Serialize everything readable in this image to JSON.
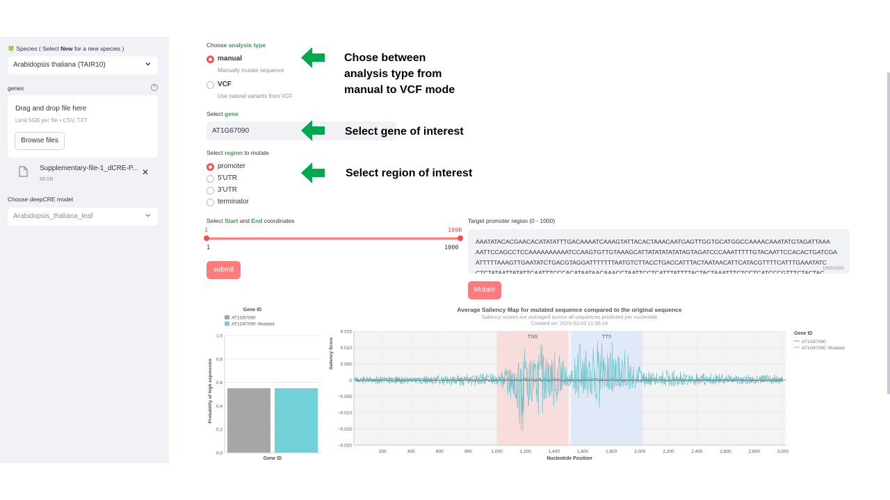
{
  "sidebar": {
    "species_label": {
      "icon": "🍀",
      "prefix": " Species ( Select ",
      "bold": "New",
      "suffix": " for a new species )"
    },
    "species_value": "Arabidopsis thaliana (TAIR10)",
    "genes_label": "genes",
    "help_glyph": "?",
    "dropzone_title": "Drag and drop file here",
    "dropzone_sub": "Limit 5GB per file • CSV, TXT",
    "browse_label": "Browse files",
    "file_name": "Supplementary-file-1_dCRE-P...",
    "file_size": "89.0B",
    "close_glyph": "✕",
    "model_label": "Choose deepCRE model",
    "model_value": "Arabidopsis_thaliana_leaf"
  },
  "main": {
    "analysis_label": {
      "pre": "Choose ",
      "hl": "analysis type"
    },
    "options": [
      {
        "label": "manual",
        "caption": "Manually mutate sequence",
        "selected": true
      },
      {
        "label": "VCF",
        "caption": "Use natural variants from VCF",
        "selected": false
      }
    ],
    "gene_label": {
      "pre": "Select ",
      "hl": "gene"
    },
    "gene_value": "AT1G67090",
    "region_label": {
      "pre": "Select ",
      "hl": "region",
      "post": " to mutate"
    },
    "regions": [
      {
        "label": "promoter",
        "selected": true
      },
      {
        "label": "5'UTR",
        "selected": false
      },
      {
        "label": "3'UTR",
        "selected": false
      },
      {
        "label": "terminator",
        "selected": false
      }
    ],
    "coords_label": {
      "pre": "Select ",
      "hl1": "Start",
      "mid": " and ",
      "hl2": "End",
      "post": " coordinates"
    },
    "slider": {
      "start": "1",
      "end": "1000",
      "min": "1",
      "max": "1000"
    },
    "submit_label": "submit",
    "target_label": "Target promoter region (0 - 1000)",
    "sequence_lines": [
      "AAATATACACGAACACATATATTTGACAAAATCAAAGTATTACACTAAACAATGAGTTGGTGCATGGCCAAAACAAATATGTAGATTAAA",
      "AATTCCAGCCTCCAAAAAAAAAATCCAAGTGTTGTAAAGCATTATATATATATAGTAGATCCCAAATTTTTGTACAATTCCACACTGATCGA",
      "ATTTTTAAAGTTGAATATCTGACGTAGGATTTTTTTAATGTCTTACCTGACCATTTACTAATAACATTCATACGTTTTCATTTGAAATATC",
      "CTCTATAATTATATTCAATTTCCCACATAATAACAAACCTAATTCCTCATTTATTTTACTACTAAATTTCTCCTCATCCCGTTTCTACTAC"
    ],
    "char_count": "1000/1000",
    "mutate_label": "Mutate"
  },
  "annotations": [
    {
      "lines": [
        "Chose between",
        "analysis type from",
        "manual to VCF mode"
      ]
    },
    {
      "lines": [
        "Select gene of interest"
      ]
    },
    {
      "lines": [
        "Select region of interest"
      ]
    }
  ],
  "colors": {
    "accent": "#ff4b4b",
    "button": "#ff7b7b",
    "arrow": "#00a84f",
    "label_green": "#3b9b54",
    "sidebar_bg": "#f0f2f6",
    "original": "#a6a6a6",
    "mutated": "#72d0d8"
  },
  "chart_data": [
    {
      "type": "bar",
      "legend_title": "Gene ID",
      "series": [
        {
          "name": "AT1G67090",
          "values": [
            0.55
          ]
        },
        {
          "name": "AT1G67090: Mutated",
          "values": [
            0.55
          ]
        }
      ],
      "xlabel": "Gene ID",
      "ylabel": "Probability of high expression",
      "ylim": [
        0,
        1.0
      ],
      "yticks": [
        "0.0",
        "0.2",
        "0.4",
        "0.6",
        "0.8",
        "1.0"
      ],
      "grid": true
    },
    {
      "type": "line",
      "title": "Average Saliency Map for mutated sequence compared to the original sequence",
      "subtitle": "Saliency scores are averaged across all sequences predicted per nucleotide",
      "subtitle2": "Created on: 2025-02-03 11:36:14",
      "xlabel": "Nucleotide Position",
      "ylabel": "Saliency Score",
      "xlim": [
        0,
        3020
      ],
      "ylim": [
        -0.02,
        0.015
      ],
      "xticks": [
        "200",
        "400",
        "600",
        "800",
        "1,000",
        "1,200",
        "1,400",
        "1,600",
        "1,800",
        "2,000",
        "2,200",
        "2,400",
        "2,600",
        "2,800",
        "3,000"
      ],
      "yticks": [
        "0.015",
        "0.010",
        "0.005",
        "0",
        "−0.005",
        "−0.010",
        "−0.015",
        "−0.020"
      ],
      "regions": [
        {
          "label": "TSS",
          "x0": 1000,
          "x1": 1500,
          "color": "#f9d7d7"
        },
        {
          "label": "TTS",
          "x0": 1520,
          "x1": 2020,
          "color": "#dbe6f7"
        }
      ],
      "legend_title": "Gene ID",
      "series": [
        {
          "name": "AT1G67090"
        },
        {
          "name": "AT1G67090: Mutated"
        }
      ],
      "envelope_x": [
        0,
        100,
        200,
        300,
        400,
        500,
        600,
        700,
        800,
        900,
        1000,
        1050,
        1100,
        1150,
        1175,
        1200,
        1250,
        1300,
        1350,
        1400,
        1450,
        1500,
        1530,
        1560,
        1580,
        1600,
        1650,
        1700,
        1750,
        1800,
        1850,
        1900,
        1950,
        2000,
        2050,
        2100,
        2150,
        2200,
        2300,
        2400,
        2500,
        2600,
        2700,
        2800,
        2900,
        3000
      ],
      "envelope_pos": [
        0.001,
        0.001,
        0.0012,
        0.0012,
        0.0012,
        0.0014,
        0.0014,
        0.0016,
        0.0018,
        0.002,
        0.002,
        0.003,
        0.005,
        0.008,
        0.009,
        0.01,
        0.009,
        0.011,
        0.01,
        0.009,
        0.007,
        0.002,
        0.0055,
        0.013,
        0.011,
        0.01,
        0.008,
        0.012,
        0.011,
        0.012,
        0.01,
        0.009,
        0.006,
        0.004,
        0.003,
        0.002,
        0.0025,
        0.0035,
        0.0025,
        0.002,
        0.002,
        0.0018,
        0.0015,
        0.0015,
        0.0015,
        0.0015
      ],
      "envelope_neg": [
        -0.001,
        -0.001,
        -0.0012,
        -0.0012,
        -0.0012,
        -0.0014,
        -0.0014,
        -0.0016,
        -0.0018,
        -0.002,
        -0.002,
        -0.003,
        -0.006,
        -0.012,
        -0.0165,
        -0.014,
        -0.009,
        -0.011,
        -0.009,
        -0.008,
        -0.005,
        -0.002,
        -0.002,
        -0.006,
        -0.005,
        -0.004,
        -0.006,
        -0.01,
        -0.006,
        -0.004,
        -0.003,
        -0.003,
        -0.0025,
        -0.0025,
        -0.002,
        -0.0015,
        -0.0015,
        -0.002,
        -0.0015,
        -0.0015,
        -0.0015,
        -0.0012,
        -0.0012,
        -0.0012,
        -0.0012,
        -0.0012
      ]
    }
  ]
}
